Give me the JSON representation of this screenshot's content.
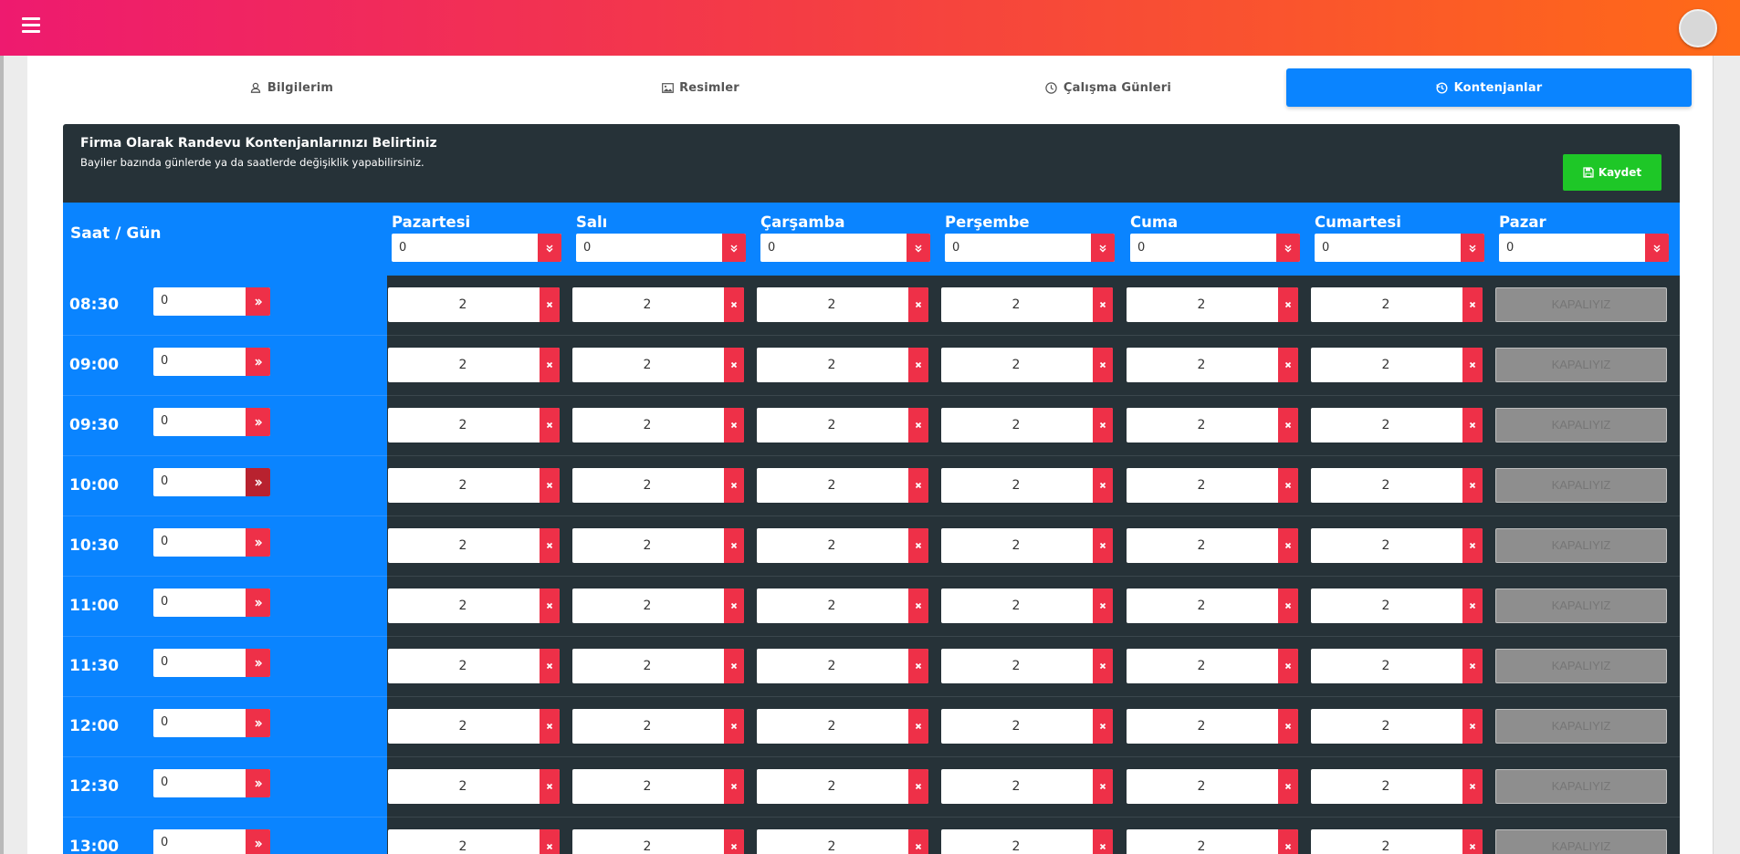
{
  "tabs": [
    {
      "label": "Bilgilerim",
      "icon": "user-icon"
    },
    {
      "label": "Resimler",
      "icon": "image-icon"
    },
    {
      "label": "Çalışma Günleri",
      "icon": "clock-icon"
    },
    {
      "label": "Kontenjanlar",
      "icon": "history-icon",
      "active": true
    }
  ],
  "panel": {
    "title": "Firma Olarak Randevu Kontenjanlarınızı Belirtiniz",
    "subtitle": "Bayiler bazında günlerde ya da saatlerde değişiklik yapabilirsiniz.",
    "save_label": "Kaydet"
  },
  "table": {
    "corner_label": "Saat / Gün",
    "days": [
      {
        "name": "Pazartesi",
        "value": "0"
      },
      {
        "name": "Salı",
        "value": "0"
      },
      {
        "name": "Çarşamba",
        "value": "0"
      },
      {
        "name": "Perşembe",
        "value": "0"
      },
      {
        "name": "Cuma",
        "value": "0"
      },
      {
        "name": "Cumartesi",
        "value": "0"
      },
      {
        "name": "Pazar",
        "value": "0"
      }
    ],
    "rows": [
      {
        "time": "08:30",
        "value": "0",
        "cells": [
          "2",
          "2",
          "2",
          "2",
          "2",
          "2"
        ],
        "closed": "KAPALIYIZ"
      },
      {
        "time": "09:00",
        "value": "0",
        "cells": [
          "2",
          "2",
          "2",
          "2",
          "2",
          "2"
        ],
        "closed": "KAPALIYIZ"
      },
      {
        "time": "09:30",
        "value": "0",
        "cells": [
          "2",
          "2",
          "2",
          "2",
          "2",
          "2"
        ],
        "closed": "KAPALIYIZ"
      },
      {
        "time": "10:00",
        "value": "0",
        "cells": [
          "2",
          "2",
          "2",
          "2",
          "2",
          "2"
        ],
        "closed": "KAPALIYIZ"
      },
      {
        "time": "10:30",
        "value": "0",
        "cells": [
          "2",
          "2",
          "2",
          "2",
          "2",
          "2"
        ],
        "closed": "KAPALIYIZ"
      },
      {
        "time": "11:00",
        "value": "0",
        "cells": [
          "2",
          "2",
          "2",
          "2",
          "2",
          "2"
        ],
        "closed": "KAPALIYIZ"
      },
      {
        "time": "11:30",
        "value": "0",
        "cells": [
          "2",
          "2",
          "2",
          "2",
          "2",
          "2"
        ],
        "closed": "KAPALIYIZ"
      },
      {
        "time": "12:00",
        "value": "0",
        "cells": [
          "2",
          "2",
          "2",
          "2",
          "2",
          "2"
        ],
        "closed": "KAPALIYIZ"
      },
      {
        "time": "12:30",
        "value": "0",
        "cells": [
          "2",
          "2",
          "2",
          "2",
          "2",
          "2"
        ],
        "closed": "KAPALIYIZ"
      },
      {
        "time": "13:00",
        "value": "0",
        "cells": [
          "2",
          "2",
          "2",
          "2",
          "2",
          "2"
        ],
        "closed": "KAPALIYIZ"
      }
    ]
  },
  "colors": {
    "accent_blue": "#0a84ff",
    "danger_red": "#ee3048",
    "success_green": "#1ec727",
    "panel_dark": "#263238"
  }
}
